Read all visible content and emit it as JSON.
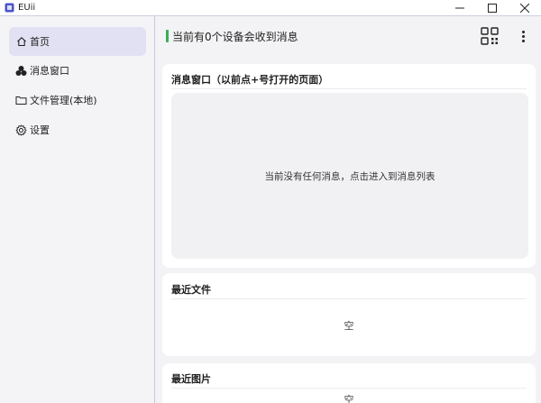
{
  "window": {
    "title": "EUii",
    "controls": {
      "minimize": "—",
      "maximize": "☐",
      "close": "✕"
    }
  },
  "sidebar": {
    "items": [
      {
        "label": "首页",
        "icon": "home-icon",
        "active": true
      },
      {
        "label": "消息窗口",
        "icon": "cluster-icon",
        "active": false
      },
      {
        "label": "文件管理(本地)",
        "icon": "folder-icon",
        "active": false
      },
      {
        "label": "设置",
        "icon": "gear-icon",
        "active": false
      }
    ]
  },
  "header": {
    "status_text": "当前有0个设备会收到消息",
    "status_color": "#3cae52"
  },
  "cards": {
    "messages": {
      "title": "消息窗口（以前点+号打开的页面）",
      "empty_text": "当前没有任何消息，点击进入到消息列表"
    },
    "recent_files": {
      "title": "最近文件",
      "empty_text": "空"
    },
    "recent_images": {
      "title": "最近图片",
      "empty_text": "空"
    }
  },
  "colors": {
    "accent": "#e1e1f3",
    "sidebar_border": "#c9c9e0"
  }
}
